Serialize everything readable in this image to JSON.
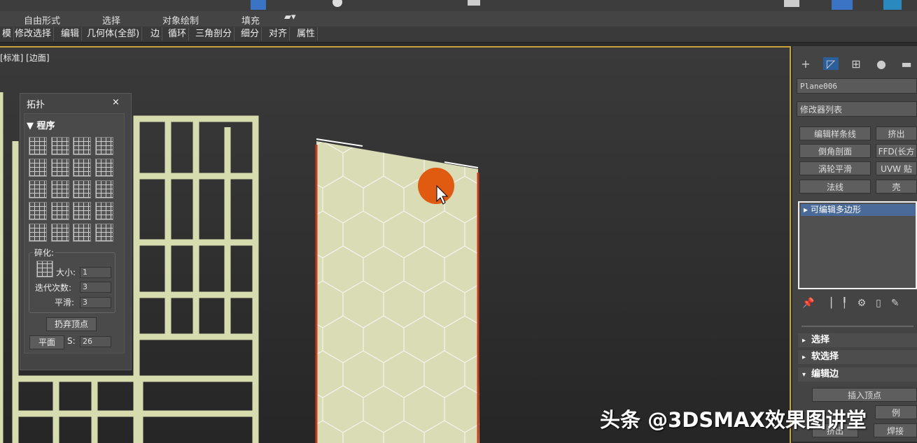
{
  "ribbon_tabs": [
    "自由形式",
    "选择",
    "对象绘制",
    "填充"
  ],
  "ribbon_buttons": [
    "模",
    "修改选择",
    "编辑",
    "几何体(全部)",
    "边",
    "循环",
    "三角剖分",
    "细分",
    "对齐",
    "属性"
  ],
  "viewport": {
    "label": "[标准] [边面]"
  },
  "topology": {
    "title": "拓扑",
    "close": "×",
    "section_program": "▼ 程序",
    "fragment_label": "碎化:",
    "size_label": "大小:",
    "size_value": "1",
    "iterations_label": "迭代次数:",
    "iterations_value": "3",
    "smooth_label": "平滑:",
    "smooth_value": "3",
    "discard_vertices": "扔弃顶点",
    "plane": "平面",
    "s_label": "S:",
    "s_value": "26"
  },
  "command_panel": {
    "object_name": "Plane006",
    "modifier_list": "修改器列表",
    "modifier_buttons": [
      "编辑样条线",
      "挤出",
      "倒角剖面",
      "FFD(长方",
      "涡轮平滑",
      "UVW 贴",
      "法线",
      "壳"
    ],
    "stack_item": "可编辑多边形",
    "rollouts": [
      "选择",
      "软选择",
      "编辑边"
    ],
    "insert_vertex": "插入顶点",
    "extrude": "挤出",
    "weld": "焊接",
    "remove": "例"
  },
  "watermark": "头条 @3DSMAX效果图讲堂",
  "colors": {
    "accent": "#c8a23a",
    "cursor_dot": "#e05a10",
    "mesh_fill": "#d9dcb4"
  }
}
